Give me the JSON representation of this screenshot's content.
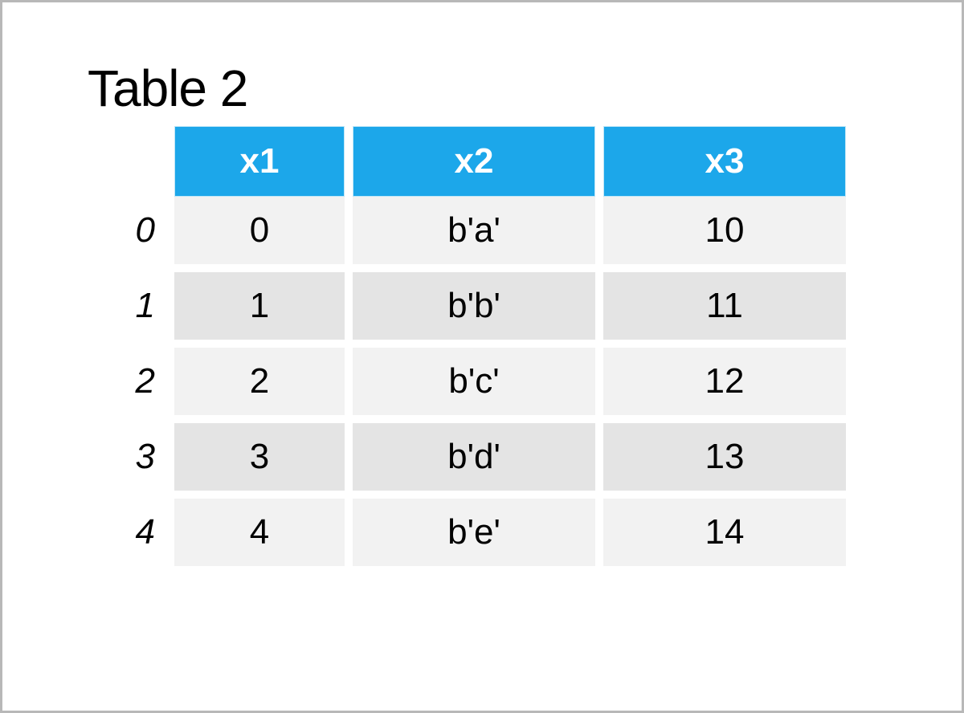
{
  "title": "Table 2",
  "columns": [
    "x1",
    "x2",
    "x3"
  ],
  "index": [
    "0",
    "1",
    "2",
    "3",
    "4"
  ],
  "rows": [
    {
      "x1": "0",
      "x2": "b'a'",
      "x3": "10"
    },
    {
      "x1": "1",
      "x2": "b'b'",
      "x3": "11"
    },
    {
      "x1": "2",
      "x2": "b'c'",
      "x3": "12"
    },
    {
      "x1": "3",
      "x2": "b'd'",
      "x3": "13"
    },
    {
      "x1": "4",
      "x2": "b'e'",
      "x3": "14"
    }
  ],
  "chart_data": {
    "type": "table",
    "title": "Table 2",
    "columns": [
      "x1",
      "x2",
      "x3"
    ],
    "index": [
      0,
      1,
      2,
      3,
      4
    ],
    "data": [
      [
        0,
        "b'a'",
        10
      ],
      [
        1,
        "b'b'",
        11
      ],
      [
        2,
        "b'c'",
        12
      ],
      [
        3,
        "b'd'",
        13
      ],
      [
        4,
        "b'e'",
        14
      ]
    ]
  }
}
